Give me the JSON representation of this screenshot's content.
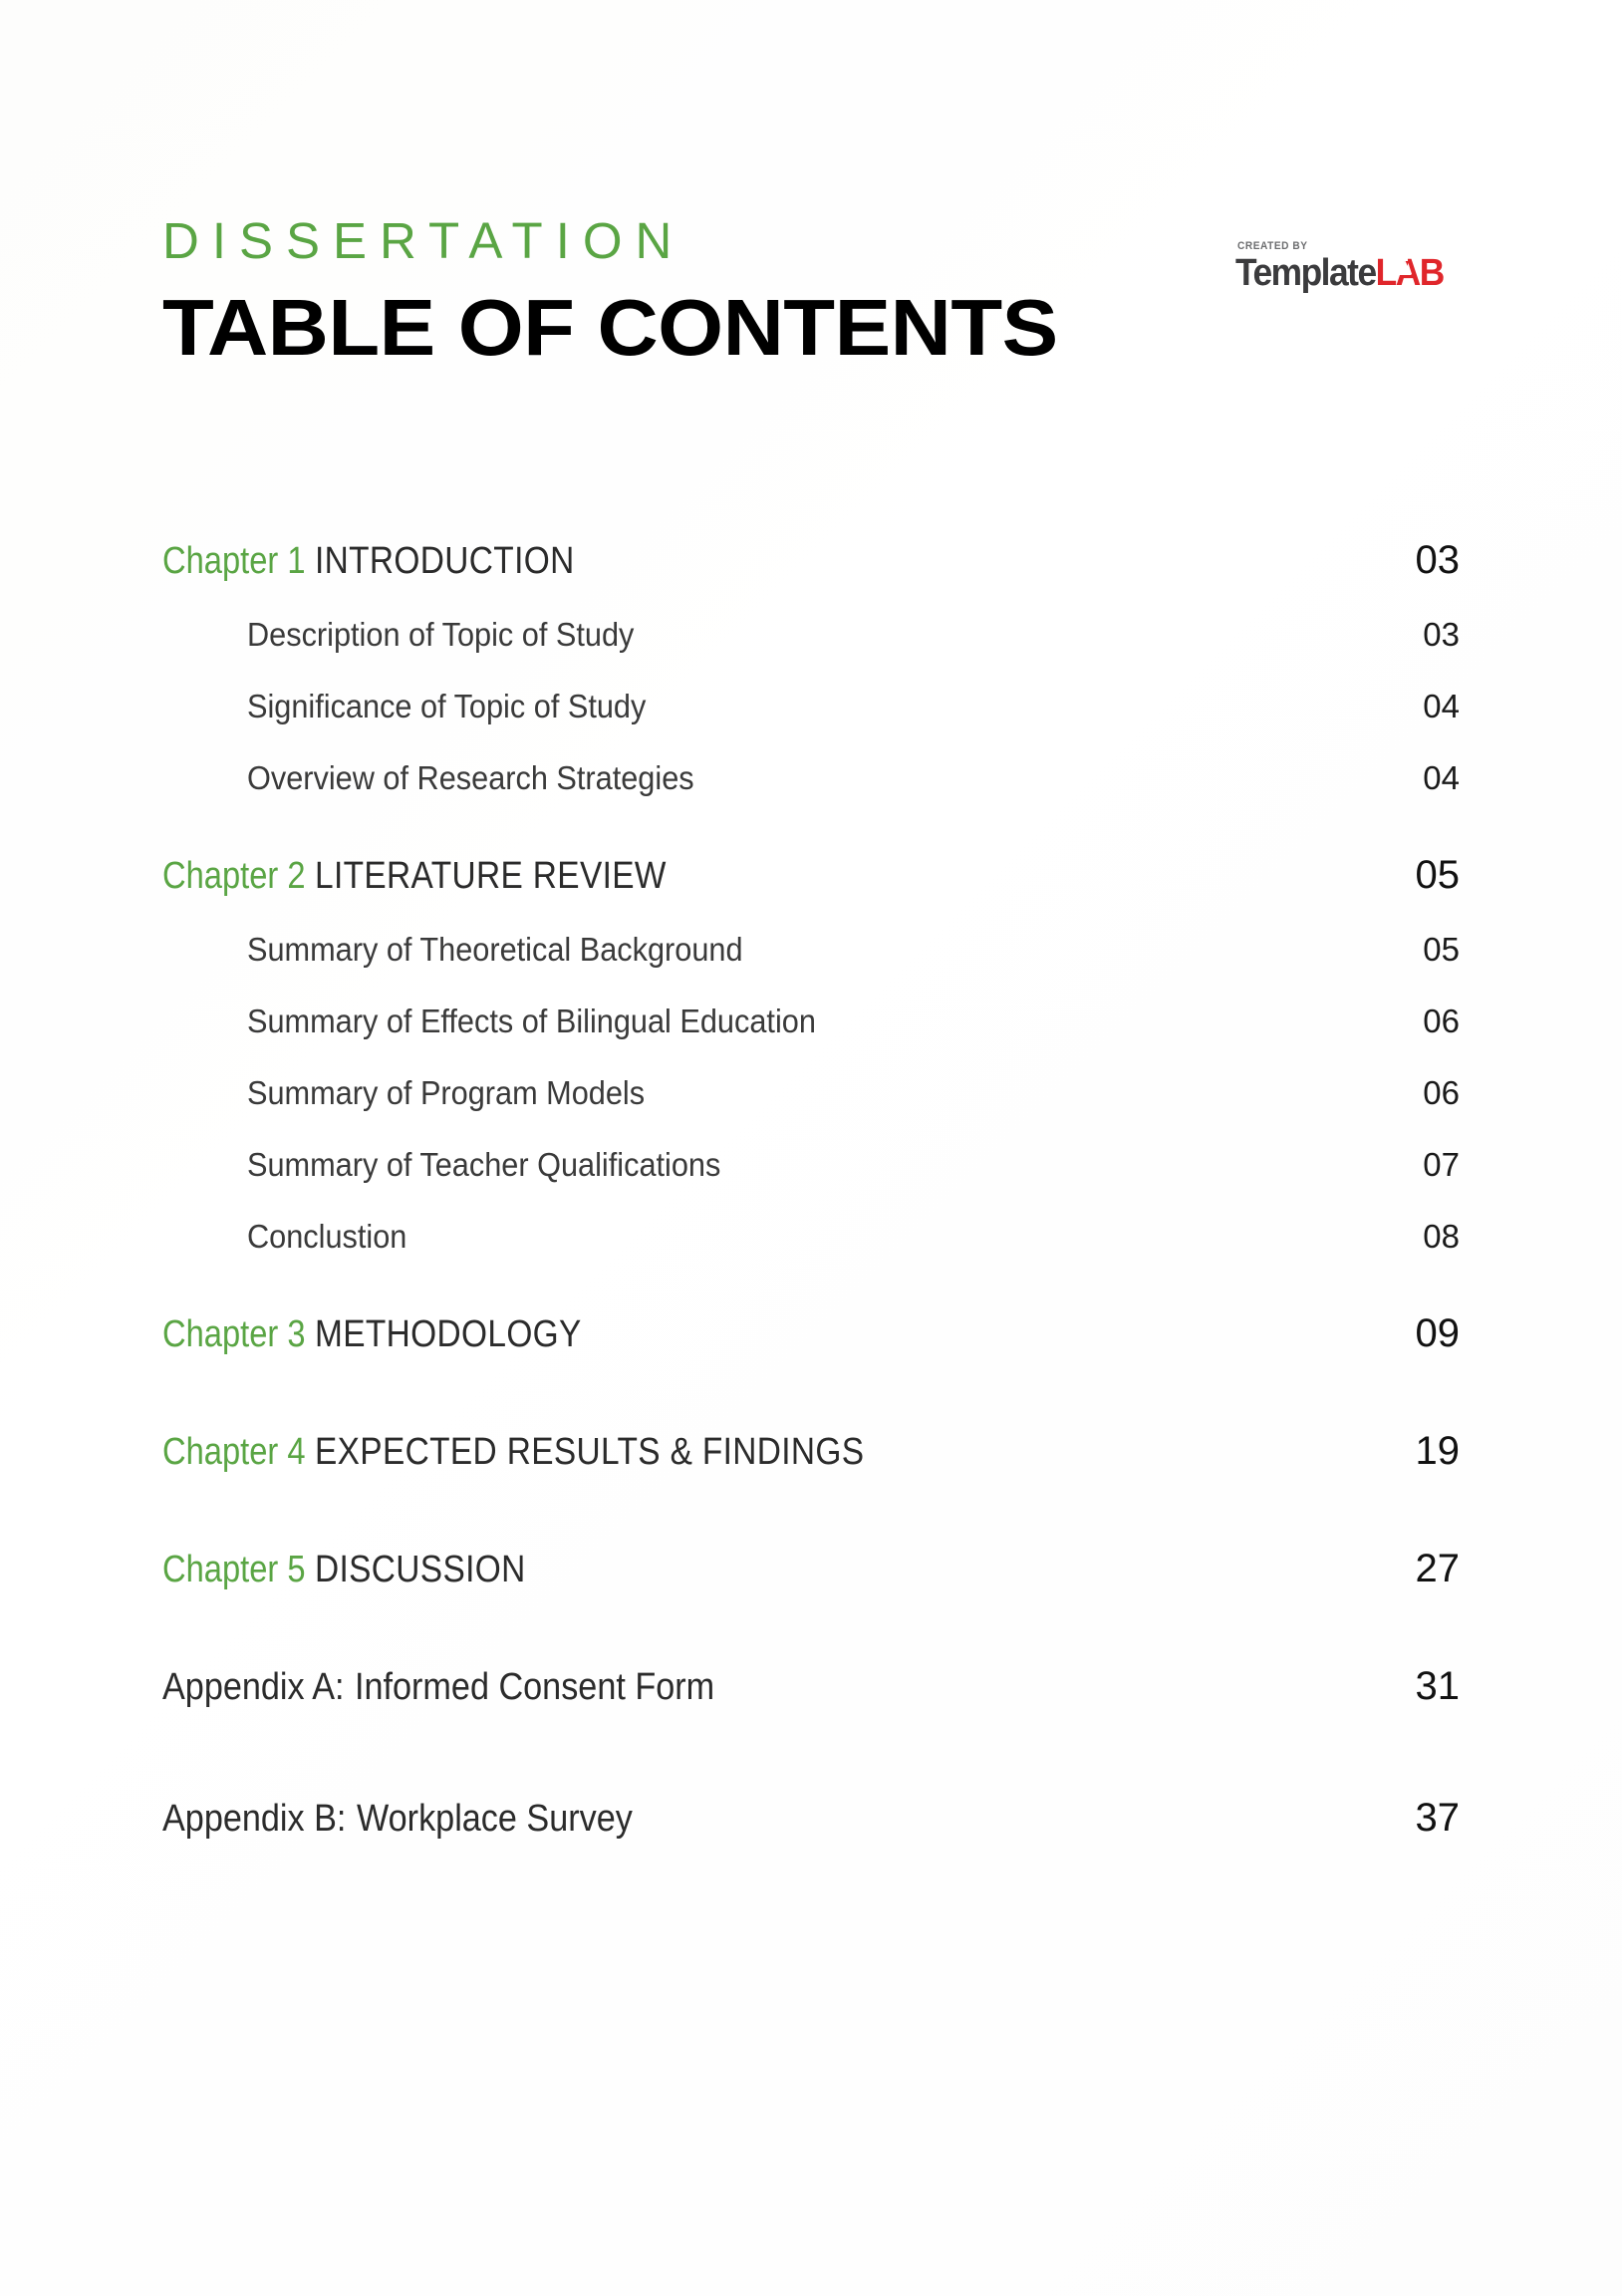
{
  "header": {
    "kicker": "DISSERTATION",
    "title": "TABLE OF CONTENTS"
  },
  "logo": {
    "created_by": "CREATED BY",
    "name_part1": "Template",
    "name_part2": "LAB",
    "color_dark": "#3b3b3d",
    "color_red": "#e0262b"
  },
  "theme": {
    "accent_green": "#5aa544",
    "text_dark": "#2b2b2b",
    "background": "#ffffff"
  },
  "toc": {
    "chapters": [
      {
        "label": "Chapter 1",
        "title": "INTRODUCTION",
        "page": "03",
        "items": [
          {
            "title": "Description of Topic of Study",
            "page": "03"
          },
          {
            "title": "Significance of Topic of Study",
            "page": "04"
          },
          {
            "title": "Overview of Research Strategies",
            "page": "04"
          }
        ]
      },
      {
        "label": "Chapter 2",
        "title": "LITERATURE REVIEW",
        "page": "05",
        "items": [
          {
            "title": "Summary of Theoretical Background",
            "page": "05"
          },
          {
            "title": "Summary of Effects of Bilingual Education",
            "page": "06"
          },
          {
            "title": "Summary of Program Models",
            "page": "06"
          },
          {
            "title": "Summary of Teacher Qualifications",
            "page": "07"
          },
          {
            "title": "Conclustion",
            "page": "08"
          }
        ]
      },
      {
        "label": "Chapter 3",
        "title": "METHODOLOGY",
        "page": "09",
        "items": []
      },
      {
        "label": "Chapter 4",
        "title": "EXPECTED RESULTS & FINDINGS",
        "page": "19",
        "items": []
      },
      {
        "label": "Chapter 5",
        "title": "DISCUSSION",
        "page": "27",
        "items": []
      }
    ],
    "appendices": [
      {
        "label": "Appendix A:",
        "title": "Informed Consent Form",
        "page": "31"
      },
      {
        "label": "Appendix B:",
        "title": "Workplace Survey",
        "page": "37"
      }
    ]
  }
}
